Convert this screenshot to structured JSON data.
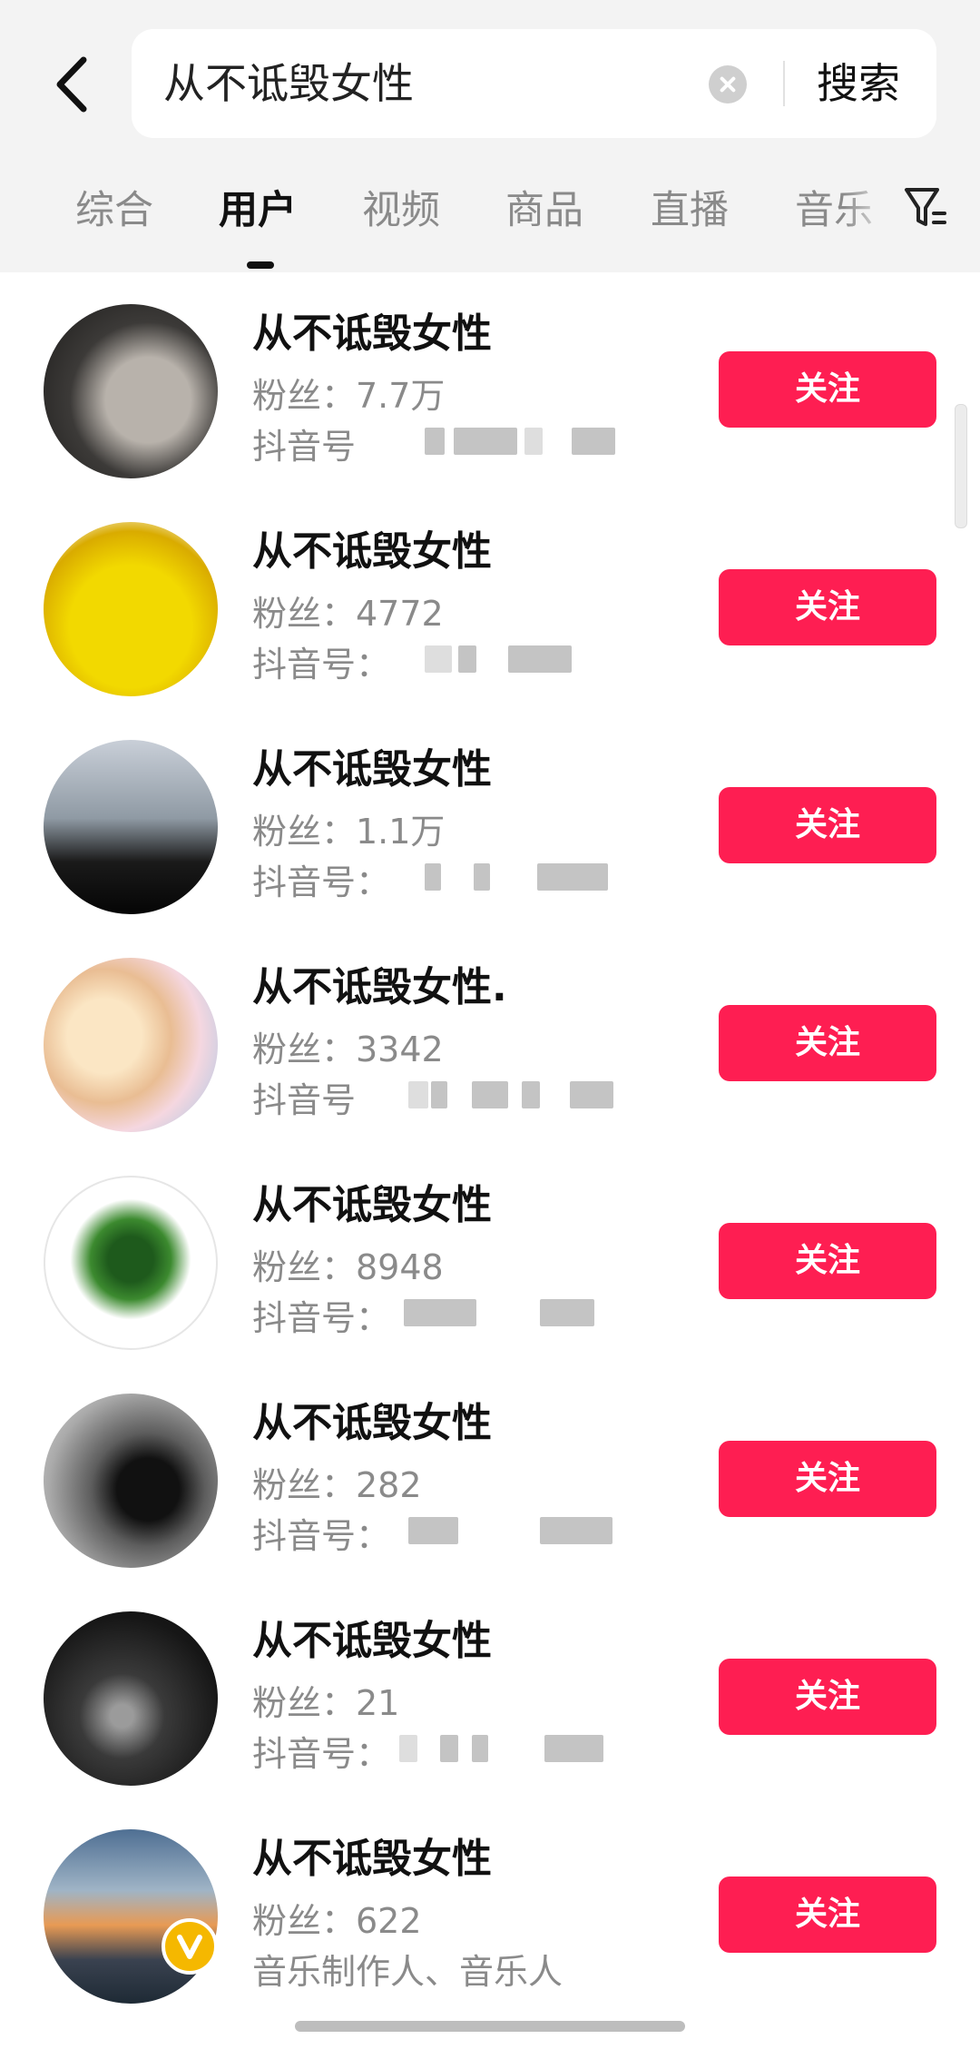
{
  "search": {
    "query": "从不诋毁女性",
    "button_label": "搜索"
  },
  "tabs": [
    {
      "label": "综合",
      "active": false
    },
    {
      "label": "用户",
      "active": true
    },
    {
      "label": "视频",
      "active": false
    },
    {
      "label": "商品",
      "active": false
    },
    {
      "label": "直播",
      "active": false
    },
    {
      "label": "音乐",
      "active": false
    }
  ],
  "users": [
    {
      "name": "从不诋毁女性",
      "fans": "粉丝：7.7万",
      "line3": "抖音号"
    },
    {
      "name": "从不诋毁女性",
      "fans": "粉丝：4772",
      "line3": "抖音号："
    },
    {
      "name": "从不诋毁女性",
      "fans": "粉丝：1.1万",
      "line3": "抖音号："
    },
    {
      "name": "从不诋毁女性.",
      "fans": "粉丝：3342",
      "line3": "抖音号"
    },
    {
      "name": "从不诋毁女性",
      "fans": "粉丝：8948",
      "line3": "抖音号："
    },
    {
      "name": "从不诋毁女性",
      "fans": "粉丝：282",
      "line3": "抖音号："
    },
    {
      "name": "从不诋毁女性",
      "fans": "粉丝：21",
      "line3": "抖音号："
    },
    {
      "name": "从不诋毁女性",
      "fans": "粉丝：622",
      "line3": "音乐制作人、音乐人"
    }
  ],
  "follow_label": "关注",
  "colors": {
    "accent": "#fe1e52",
    "header_bg": "#f3f3f3",
    "verified_badge": "#f5b800"
  },
  "icons": {
    "back": "chevron-left-icon",
    "clear": "clear-circle-icon",
    "filter": "filter-icon",
    "verified": "verified-v-icon"
  }
}
